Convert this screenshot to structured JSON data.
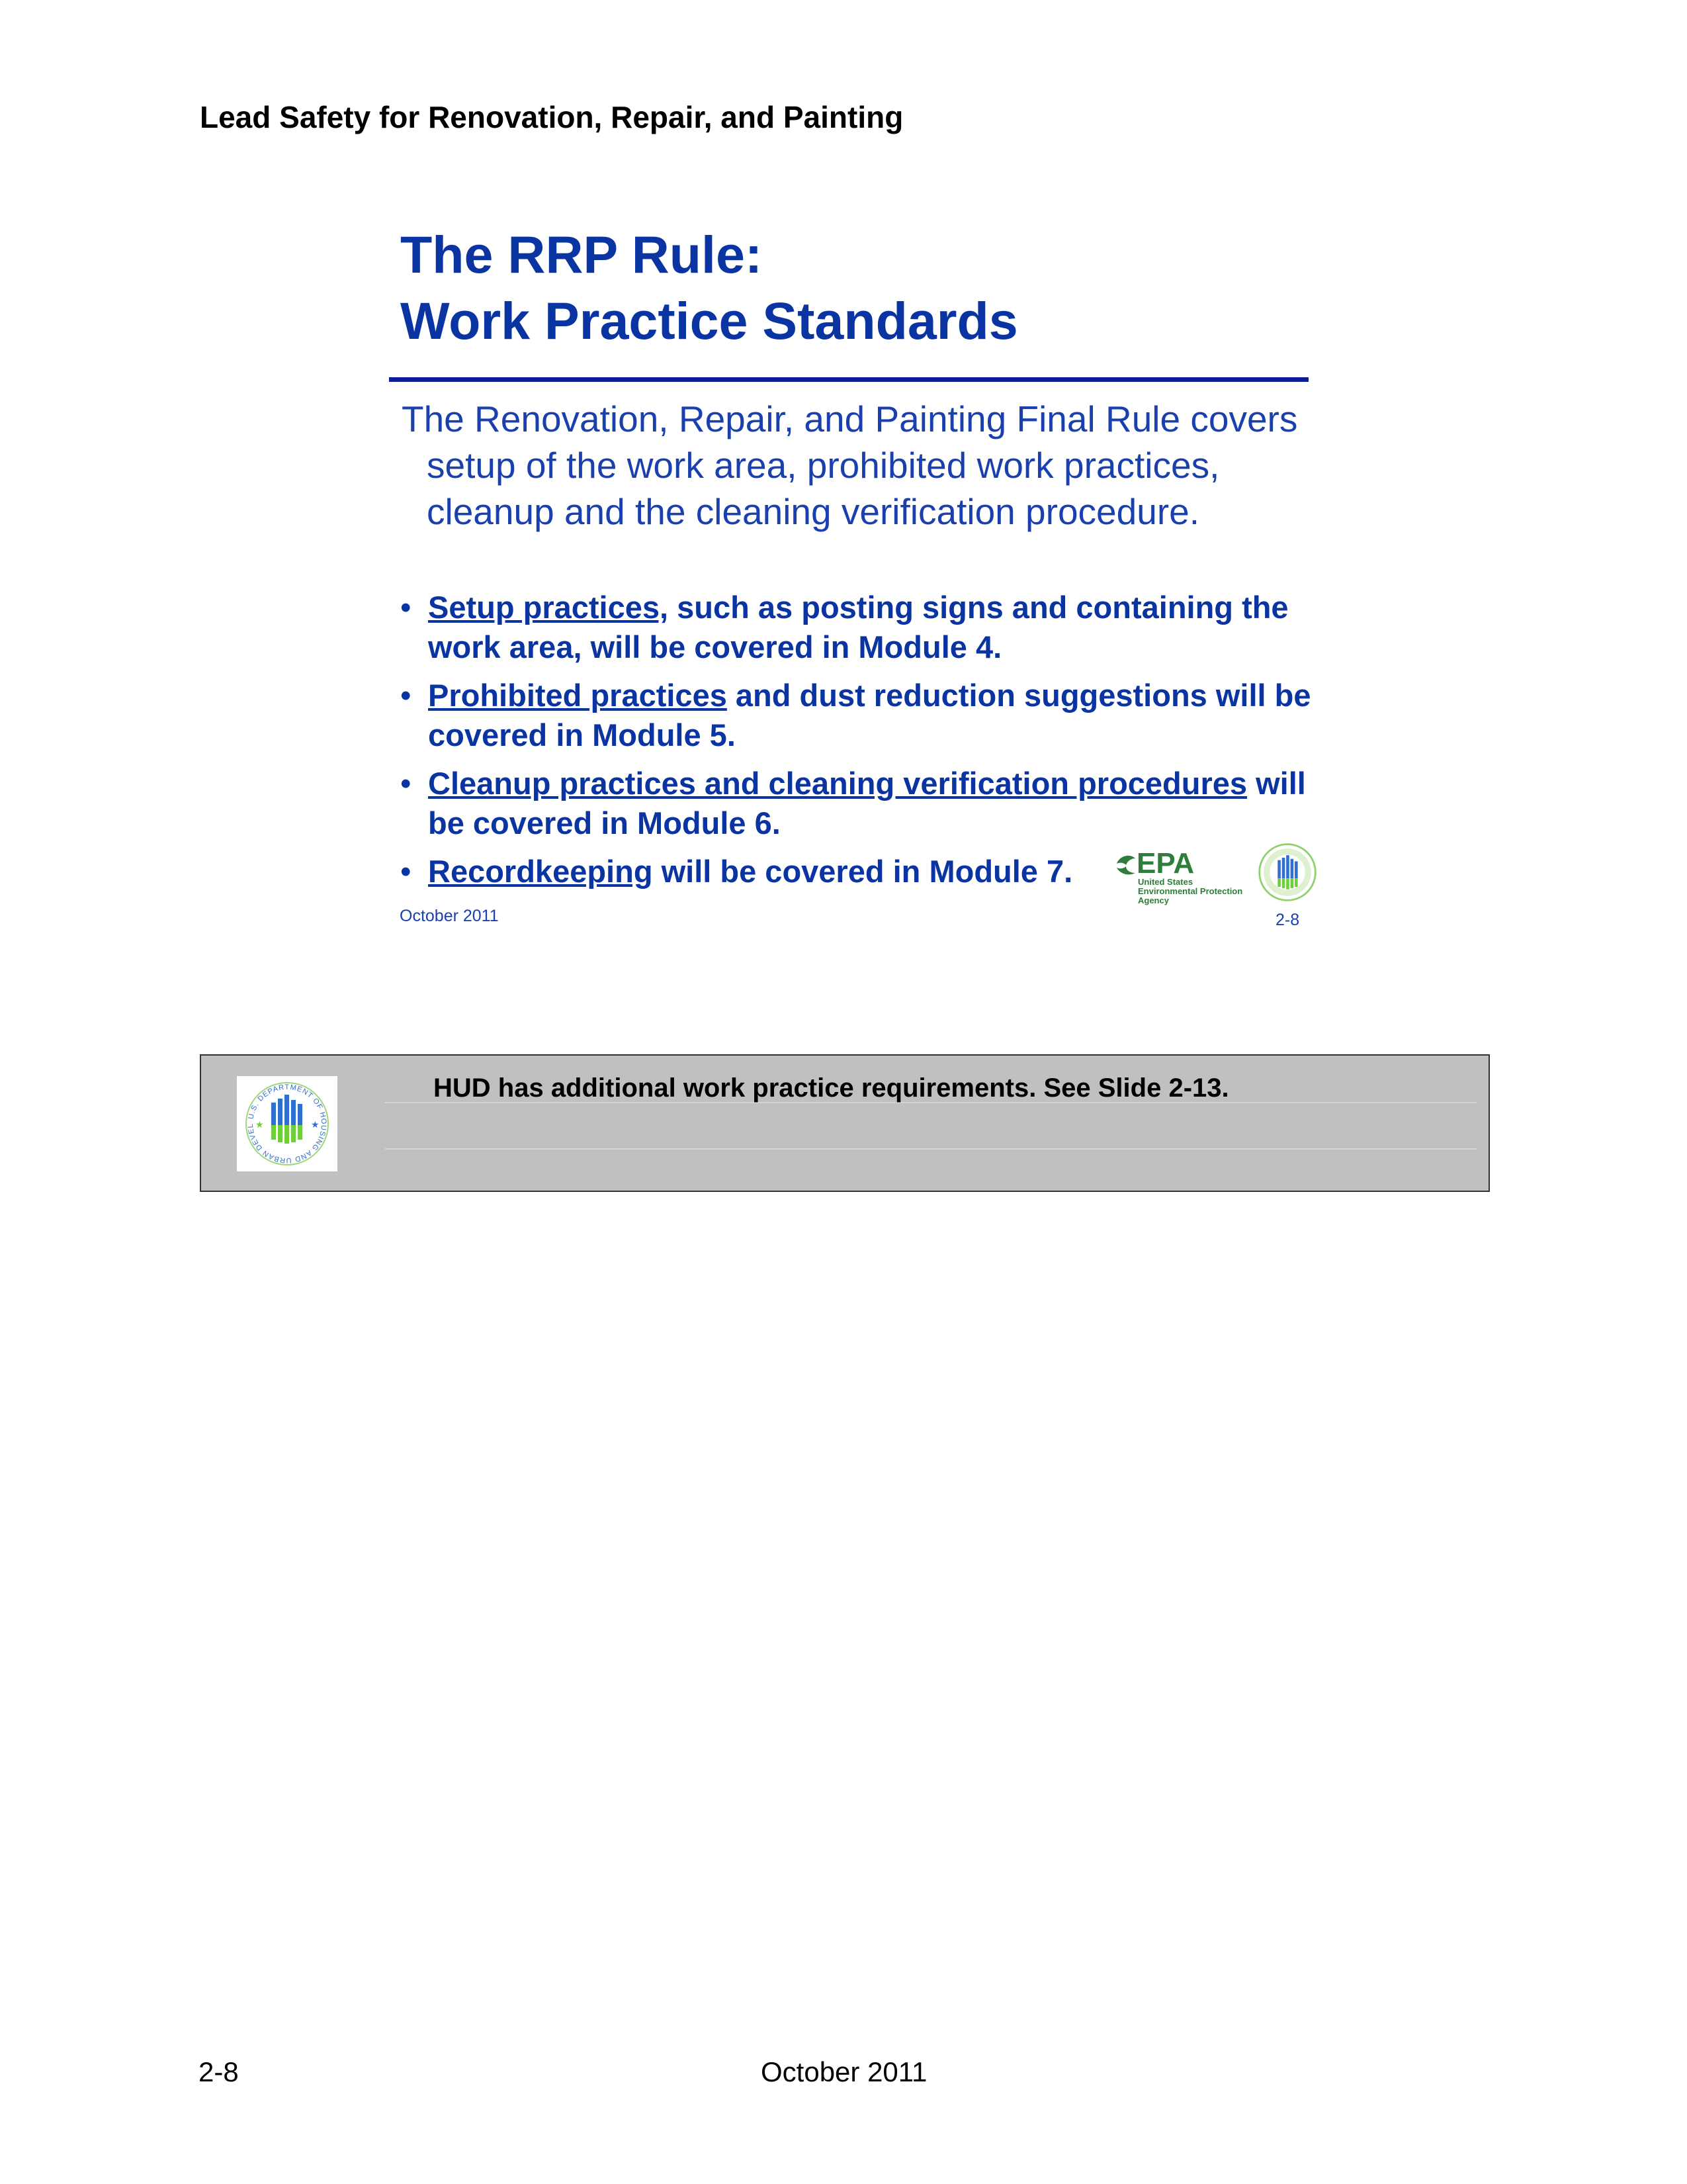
{
  "header": {
    "title": "Lead Safety for Renovation, Repair, and Painting"
  },
  "slide": {
    "title_line1": "The RRP Rule:",
    "title_line2": "Work Practice Standards",
    "intro": "The Renovation, Repair, and Painting Final Rule covers setup of the work area, prohibited work practices, cleanup and the cleaning verification procedure.",
    "bullets": [
      {
        "link": "Setup practices,",
        "rest": " such as posting signs and containing the work area, will be covered in Module 4."
      },
      {
        "link": "Prohibited practices",
        "rest": " and dust reduction suggestions will be covered in Module 5."
      },
      {
        "link": "Cleanup practices and cleaning verification procedures",
        "rest": " will be covered in Module 6."
      },
      {
        "link": "Recordkeeping",
        "rest": " will be covered in Module 7."
      }
    ],
    "date": "October 2011",
    "number": "2-8",
    "epa_logo": {
      "wordmark": "EPA",
      "line1": "United States",
      "line2": "Environmental Protection",
      "line3": "Agency",
      "color": "#2e7d3a"
    },
    "hud_seal_small_icon": "hud-seal-icon"
  },
  "note": {
    "text": "HUD has additional work practice requirements. See Slide 2-13.",
    "background": "#c0c0c0",
    "seal_icon": "hud-seal-icon",
    "seal_text": "U.S. DEPARTMENT OF HOUSING AND URBAN DEVELOPMENT"
  },
  "footer": {
    "page": "2-8",
    "date": "October 2011"
  },
  "colors": {
    "title_blue": "#0b34a3",
    "rule_blue": "#0b1d98",
    "seal_blue": "#2f6fd0",
    "seal_green": "#6fcf3a"
  }
}
